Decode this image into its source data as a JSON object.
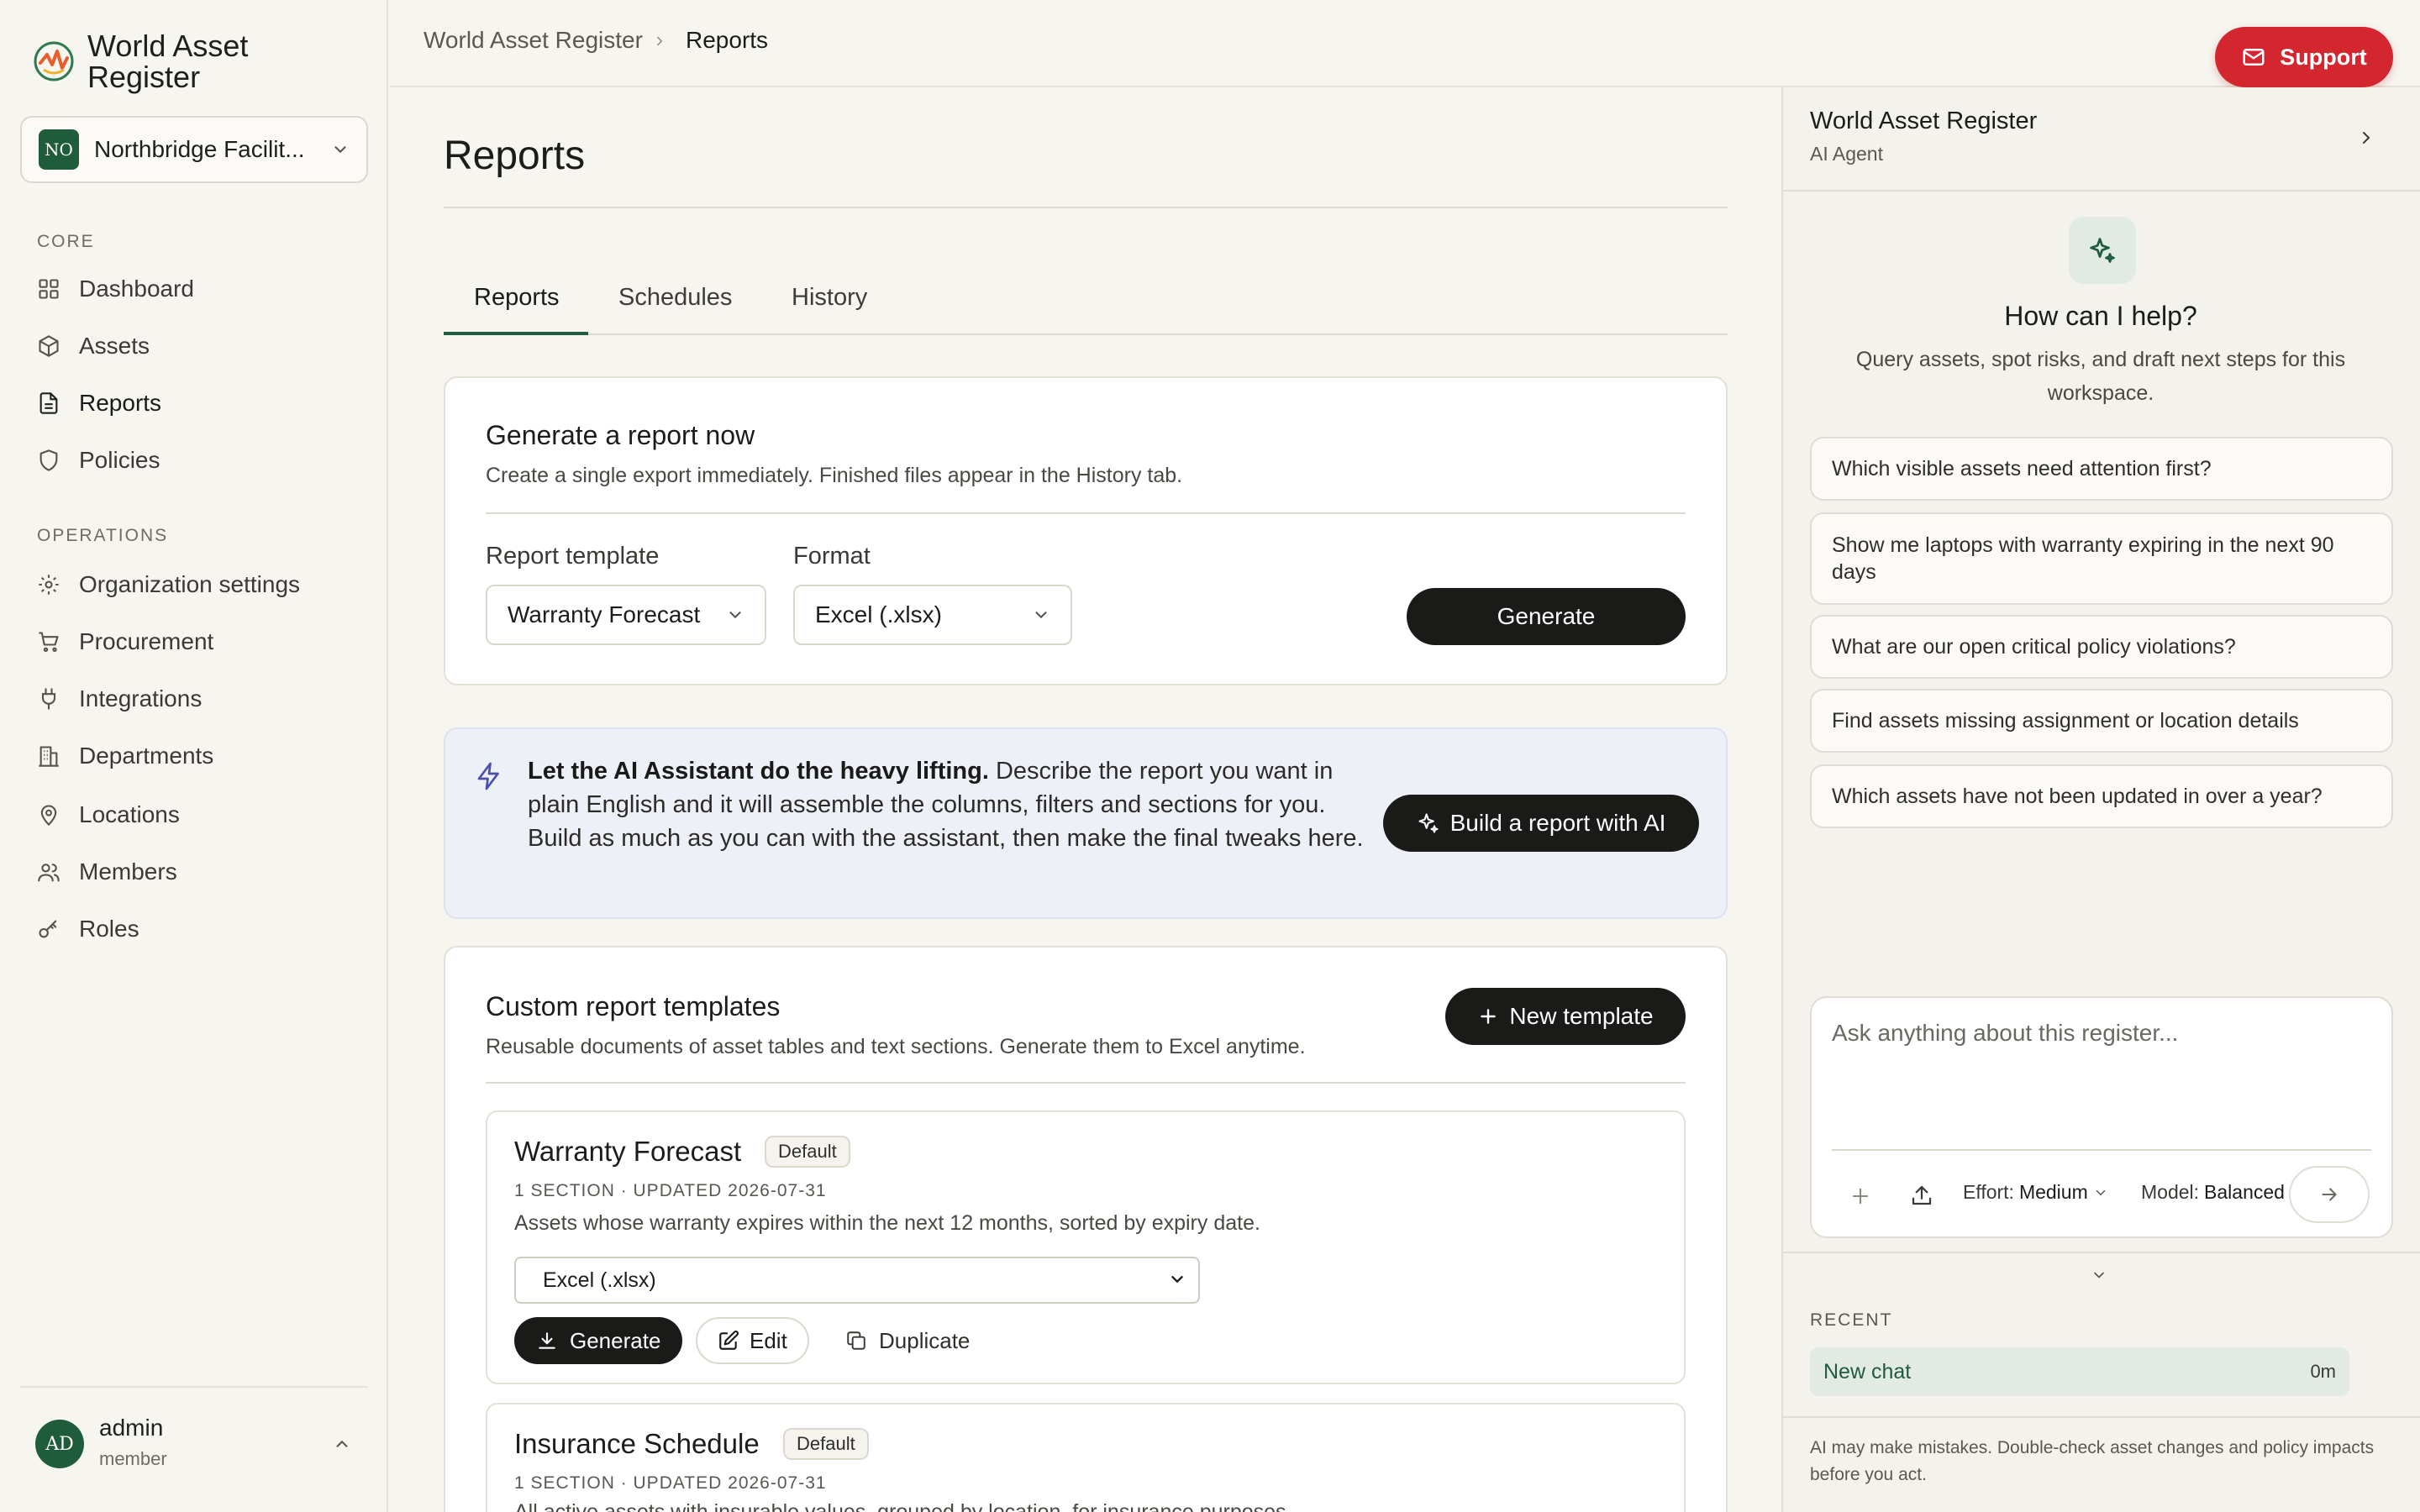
{
  "brand": {
    "name_line1": "World Asset",
    "name_line2": "Register"
  },
  "org": {
    "initials": "NO",
    "name": "Northbridge Facilit..."
  },
  "sidebar": {
    "core_label": "CORE",
    "core_items": [
      "Dashboard",
      "Assets",
      "Reports",
      "Policies"
    ],
    "operations_label": "OPERATIONS",
    "operations_items": [
      "Organization settings",
      "Procurement",
      "Integrations",
      "Departments",
      "Locations",
      "Members",
      "Roles"
    ],
    "active": "Reports"
  },
  "user": {
    "initials": "AD",
    "name": "admin",
    "role": "member"
  },
  "header": {
    "breadcrumb": [
      "World Asset Register",
      "Reports"
    ],
    "support_label": "Support"
  },
  "page": {
    "title": "Reports",
    "tabs": [
      "Reports",
      "Schedules",
      "History"
    ]
  },
  "generate": {
    "title": "Generate a report now",
    "subtitle": "Create a single export immediately. Finished files appear in the History tab.",
    "template_label": "Report template",
    "template_value": "Warranty Forecast",
    "format_label": "Format",
    "format_value": "Excel (.xlsx)",
    "button": "Generate"
  },
  "ai_banner": {
    "bold": "Let the AI Assistant do the heavy lifting.",
    "text": " Describe the report you want in plain English and it will assemble the columns, filters and sections for you. Build as much as you can with the assistant, then make the final tweaks here.",
    "button": "Build a report with AI"
  },
  "custom": {
    "title": "Custom report templates",
    "subtitle": "Reusable documents of asset tables and text sections. Generate them to Excel anytime.",
    "new_button": "New template",
    "templates": [
      {
        "name": "Warranty Forecast",
        "badge": "Default",
        "meta": "1 SECTION · UPDATED 2026-07-31",
        "description": "Assets whose warranty expires within the next 12 months, sorted by expiry date.",
        "format": "Excel (.xlsx)",
        "generate": "Generate",
        "edit": "Edit",
        "duplicate": "Duplicate"
      },
      {
        "name": "Insurance Schedule",
        "badge": "Default",
        "meta": "1 SECTION · UPDATED 2026-07-31",
        "description": "All active assets with insurable values, grouped by location, for insurance purposes."
      }
    ]
  },
  "agent": {
    "title": "World Asset Register",
    "subtitle": "AI Agent",
    "help_title": "How can I help?",
    "help_sub": "Query assets, spot risks, and draft next steps for this workspace.",
    "suggestions": [
      "Which visible assets need attention first?",
      "Show me laptops with warranty expiring in the next 90 days",
      "What are our open critical policy violations?",
      "Find assets missing assignment or location details",
      "Which assets have not been updated in over a year?"
    ],
    "placeholder": "Ask anything about this register...",
    "effort_label": "Effort:",
    "effort_value": "Medium",
    "model_label": "Model:",
    "model_value": "Balanced",
    "recent_label": "RECENT",
    "recent_item": "New chat",
    "recent_time": "0m",
    "disclaimer": "AI may make mistakes. Double-check asset changes and policy impacts before you act."
  },
  "colors": {
    "accent_green": "#1f5c3b",
    "support_red": "#d4262f",
    "dark_button": "#1a1a18"
  }
}
